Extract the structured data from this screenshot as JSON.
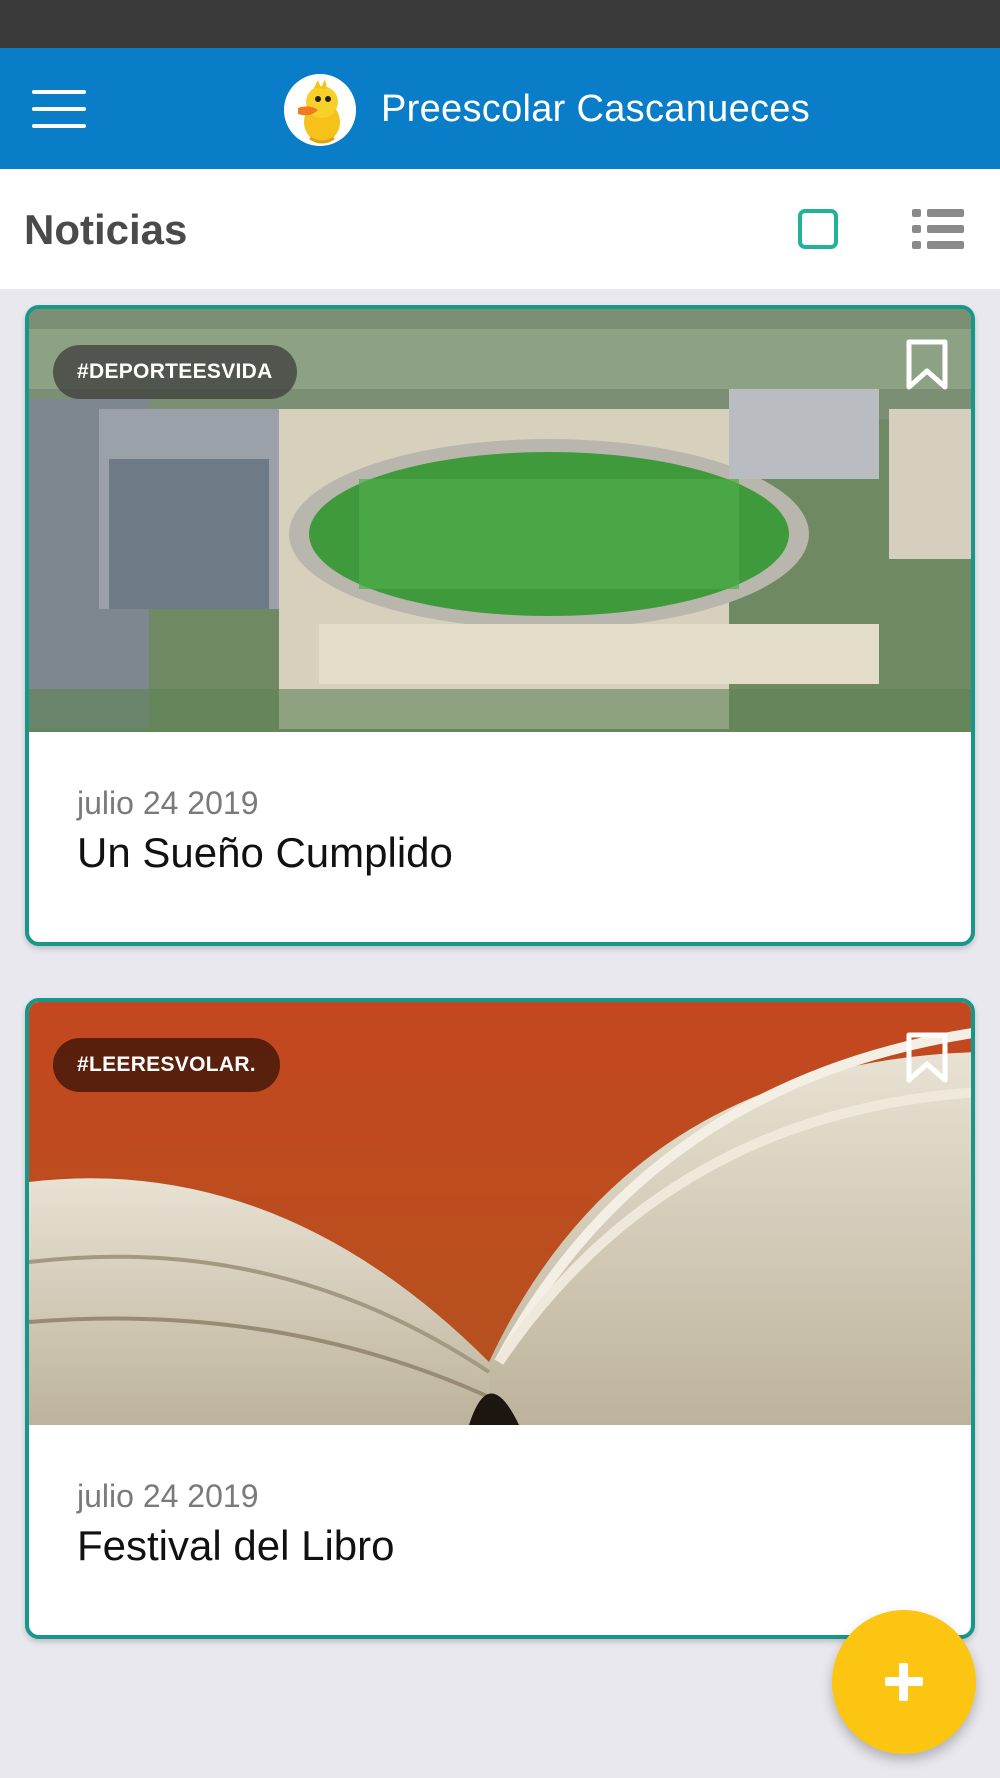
{
  "app_bar": {
    "title": "Preescolar Cascanueces",
    "menu_icon": "hamburger-menu-icon",
    "logo": "duck-logo"
  },
  "header": {
    "title": "Noticias",
    "grid_view_icon": "grid-view-icon",
    "list_view_icon": "list-view-icon",
    "accent_color": "#1fb49a"
  },
  "news": [
    {
      "tag": "#DEPORTEESVIDA",
      "date": "julio 24 2019",
      "title": "Un Sueño Cumplido",
      "image": "stadium-aerial-photo"
    },
    {
      "tag": "#LEERESVOLAR.",
      "date": "julio 24 2019",
      "title": "Festival del Libro",
      "image": "open-book-photo"
    }
  ],
  "fab": {
    "icon": "plus-icon",
    "color": "#fbc511"
  },
  "colors": {
    "app_bar": "#0a7dc9",
    "card_border": "#17968a",
    "background": "#e9e8ee"
  }
}
